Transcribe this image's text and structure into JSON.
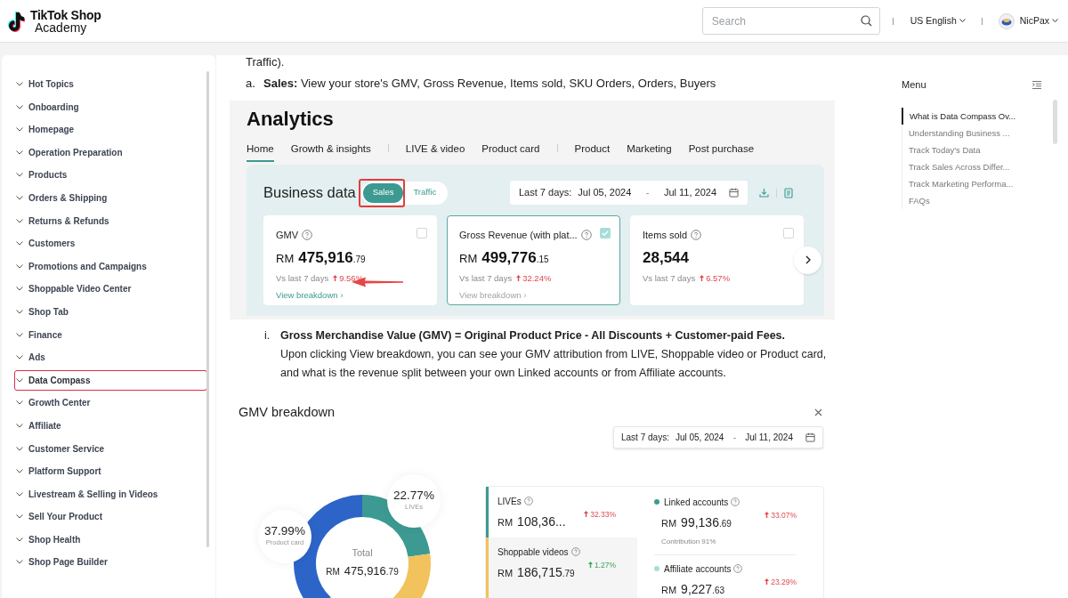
{
  "header": {
    "logo_line1": "TikTok Shop",
    "logo_line2": "Academy",
    "search": {
      "placeholder": "Search"
    },
    "language": "US English",
    "user": "NicPax"
  },
  "sidebar": {
    "items": [
      {
        "label": "Hot Topics",
        "selected": false
      },
      {
        "label": "Onboarding",
        "selected": false
      },
      {
        "label": "Homepage",
        "selected": false
      },
      {
        "label": "Operation Preparation",
        "selected": false
      },
      {
        "label": "Products",
        "selected": false
      },
      {
        "label": "Orders & Shipping",
        "selected": false
      },
      {
        "label": "Returns & Refunds",
        "selected": false
      },
      {
        "label": "Customers",
        "selected": false
      },
      {
        "label": "Promotions and Campaigns",
        "selected": false
      },
      {
        "label": "Shoppable Video Center",
        "selected": false
      },
      {
        "label": "Shop Tab",
        "selected": false
      },
      {
        "label": "Finance",
        "selected": false
      },
      {
        "label": "Ads",
        "selected": false
      },
      {
        "label": "Data Compass",
        "selected": true
      },
      {
        "label": "Growth Center",
        "selected": false
      },
      {
        "label": "Affiliate",
        "selected": false
      },
      {
        "label": "Customer Service",
        "selected": false
      },
      {
        "label": "Platform Support",
        "selected": false
      },
      {
        "label": "Livestream & Selling in Videos",
        "selected": false
      },
      {
        "label": "Sell Your Product",
        "selected": false
      },
      {
        "label": "Shop Health",
        "selected": false
      },
      {
        "label": "Shop Page Builder",
        "selected": false
      }
    ]
  },
  "article": {
    "lead_fragment": "Traffic).",
    "list_item": {
      "marker": "a.",
      "text": "**Sales:** View your store's GMV, Gross Revenue, Items sold, SKU Orders, Orders, Buyers"
    },
    "analytics_screenshot": {
      "title": "Analytics",
      "tabs": [
        {
          "label": "Home",
          "selected": true,
          "divider_before": false
        },
        {
          "label": "Growth & insights",
          "selected": false,
          "divider_before": false
        },
        {
          "label": "LIVE & video",
          "selected": false,
          "divider_before": true
        },
        {
          "label": "Product card",
          "selected": false,
          "divider_before": false
        },
        {
          "label": "Product",
          "selected": false,
          "divider_before": true
        },
        {
          "label": "Marketing",
          "selected": false,
          "divider_before": false
        },
        {
          "label": "Post purchase",
          "selected": false,
          "divider_before": false
        }
      ],
      "section_title": "Business data",
      "toggle": [
        {
          "label": "Sales",
          "selected": true
        },
        {
          "label": "Traffic",
          "selected": false
        }
      ],
      "date_range": {
        "label": "Last 7 days:",
        "start": "Jul 05, 2024",
        "separator": "-",
        "end": "Jul 11, 2024"
      },
      "cards": [
        {
          "title": "GMV",
          "checked": false,
          "selected": false,
          "currency": "RM",
          "value": "475,916",
          "decimals": ".79",
          "compare_label": "Vs last 7 days",
          "change": {
            "text": "9.56%",
            "color": "#e0484f"
          },
          "link": "View breakdown ›",
          "link_disabled": false
        },
        {
          "title": "Gross Revenue (with plat...",
          "checked": true,
          "selected": true,
          "currency": "RM",
          "value": "499,776",
          "decimals": ".15",
          "compare_label": "Vs last 7 days",
          "change": {
            "text": "32.24%",
            "color": "#e0484f"
          },
          "link": "View breakdown ›",
          "link_disabled": true
        },
        {
          "title": "Items sold",
          "checked": false,
          "selected": false,
          "value": "28,544",
          "compare_label": "Vs last 7 days",
          "change": {
            "text": "6.57%",
            "color": "#e0484f"
          }
        }
      ]
    },
    "sub_item": {
      "marker": "i.",
      "heading": "Gross Merchandise Value (GMV) = Original Product Price - All Discounts + Customer-paid Fees.",
      "text": "Upon clicking View breakdown, you can see your GMV attribution from LIVE, Shoppable video or Product card, and what is the revenue split between your own Linked accounts or from Affiliate accounts."
    },
    "gmv_breakdown": {
      "title": "GMV breakdown",
      "date_range": {
        "label": "Last 7 days:",
        "start": "Jul 05, 2024",
        "separator": "-",
        "end": "Jul 11, 2024"
      },
      "donut_labels": [
        {
          "value": "22.77%",
          "label": "LIVEs"
        },
        {
          "value": "37.99%",
          "label": "Product card"
        }
      ],
      "total": {
        "label": "Total",
        "currency": "RM",
        "value": "475,916",
        "decimals": ".79"
      },
      "channels": [
        {
          "name": "LIVEs",
          "currency": "RM",
          "value": "108,36...",
          "change": {
            "text": "32.33%",
            "color": "#e0484f"
          },
          "color": "#3c9a92",
          "selected": false
        },
        {
          "name": "Shoppable videos",
          "currency": "RM",
          "value": "186,715",
          "decimals": ".79",
          "change": {
            "text": "1.27%",
            "color": "#3aa55d"
          },
          "color": "#f2c25c",
          "selected": true
        }
      ],
      "accounts": [
        {
          "name": "Linked accounts",
          "color": "#3c9a92",
          "currency": "RM",
          "value": "99,136",
          "decimals": ".69",
          "change": {
            "text": "33.07%",
            "color": "#e0484f"
          },
          "note": "Contribution 91%"
        },
        {
          "name": "Affiliate accounts",
          "color": "#a9dcd9",
          "currency": "RM",
          "value": "9,227",
          "decimals": ".63",
          "change": {
            "text": "23.29%",
            "color": "#e0484f"
          }
        }
      ]
    }
  },
  "toc": {
    "title": "Menu",
    "items": [
      {
        "label": "What is Data Compass Ov...",
        "selected": true
      },
      {
        "label": "Understanding Business ...",
        "selected": false
      },
      {
        "label": "Track Today's Data",
        "selected": false
      },
      {
        "label": "Track Sales Across Differ...",
        "selected": false
      },
      {
        "label": "Track Marketing Performa...",
        "selected": false
      },
      {
        "label": "FAQs",
        "selected": false
      }
    ]
  }
}
